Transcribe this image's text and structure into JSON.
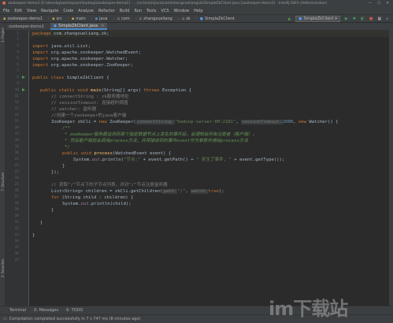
{
  "titlebar": {
    "title": "zookeeper-demo1 [E:\\develop\\workspace\\hadoop\\zookeeper-demo1] - ...\\src\\main\\java\\com\\zhangxueliang\\zk\\SimpleZkClient.java [zookeeper-demo1] - IntelliJ IDEA (Administrator)",
    "minimize": "—",
    "maximize": "☐",
    "close": "✕"
  },
  "menu": [
    "File",
    "Edit",
    "View",
    "Navigate",
    "Code",
    "Analyze",
    "Refactor",
    "Build",
    "Run",
    "Tools",
    "VCS",
    "Window",
    "Help"
  ],
  "breadcrumbs": [
    {
      "label": "zookeeper-demo1",
      "icon": "folder-icon"
    },
    {
      "label": "src",
      "icon": "folder-icon"
    },
    {
      "label": "main",
      "icon": "folder-icon"
    },
    {
      "label": "java",
      "icon": "folder-icon"
    },
    {
      "label": "com",
      "icon": "package-icon"
    },
    {
      "label": "zhangxueliang",
      "icon": "package-icon"
    },
    {
      "label": "zk",
      "icon": "package-icon"
    },
    {
      "label": "SimpleZkClient",
      "icon": "class-icon"
    }
  ],
  "run_config": "SimpleZkClient",
  "left_tabs": [
    "1: Project",
    "7: Structure"
  ],
  "left_tabs_bottom": [
    "2: Favorites"
  ],
  "project_tab": "zookeeper-demo1",
  "editor_tab": {
    "label": "SimpleZkClient.java",
    "close": "×"
  },
  "gutter_numbers": [
    "1",
    "2",
    "3",
    "4",
    "5",
    "6",
    "7",
    "8",
    "9",
    "10",
    "11",
    "12",
    "13",
    "14",
    "15",
    "16",
    "17",
    "18",
    "19",
    "20",
    "21",
    "22",
    "23",
    "24",
    "25",
    "26",
    "27",
    "28",
    "29",
    "30",
    "31",
    "32",
    "33",
    "34",
    "35",
    "36",
    "37"
  ],
  "code": {
    "l1": [
      "package ",
      "com.zhangxueliang.zk;"
    ],
    "l3": [
      "import ",
      "java.util.List;"
    ],
    "l4": [
      "import ",
      "org.apache.zookeeper.WatchedEvent;"
    ],
    "l5": [
      "import ",
      "org.apache.zookeeper.Watcher;"
    ],
    "l6": [
      "import ",
      "org.apache.zookeeper.ZooKeeper;"
    ],
    "l8": [
      "public class ",
      "SimpleZkClient {"
    ],
    "l10": [
      "public static void ",
      "main",
      "(String[] args) ",
      "throws ",
      "Exception {"
    ],
    "l11": "// connectString : zk服务器地址",
    "l12": "// sessionTimeout: 连接超时阈值",
    "l13": "// watcher: 监听器",
    "l14": "//创建一个zookeeper的java客户端",
    "l15": [
      "ZooKeeper zkCli = ",
      "new ",
      "ZooKeeper(",
      "connectString:",
      "\"hadoop-server-00:2181\"",
      ", ",
      "sessionTimeout:",
      "2000",
      ", ",
      "new ",
      "Watcher() {"
    ],
    "l16": "/**",
    "l17": "* zookeeper服务器监测到某个指定数据节点上发生的事件后，会通知给所有注册者（客户端），",
    "l18": "* 然后客户端就会调用process方法，并将接收到的事件event作为参数传递给process方法",
    "l19": "*/",
    "l20": [
      "public void ",
      "process",
      "(WatchedEvent event) {"
    ],
    "l21": [
      "System.",
      "out",
      ".println(",
      "\"节点:\"",
      " + event.getPath() + ",
      "\" 发生了事件, \"",
      " + event.getType());"
    ],
    "l22": "}",
    "l23": "});",
    "l25": "// 获取\"/\"节点下的子节点列表，并对\"/\"节点注册监听器",
    "l26": [
      "List<String> children = zkCli.getChildren(",
      "path:",
      "\"/\"",
      ", ",
      "watch:",
      "true",
      ");"
    ],
    "l27": [
      "for ",
      "(String child : children) {"
    ],
    "l28": [
      "System.",
      "out",
      ".println(child);"
    ],
    "l29": "}",
    "l31": "}",
    "l33": "}"
  },
  "bottom_tools": [
    "Terminal",
    "0: Messages",
    "6: TODO"
  ],
  "status": "Compilation completed successfully in 7 s 747 ms (8 minutes ago)",
  "watermark": "im下载站"
}
